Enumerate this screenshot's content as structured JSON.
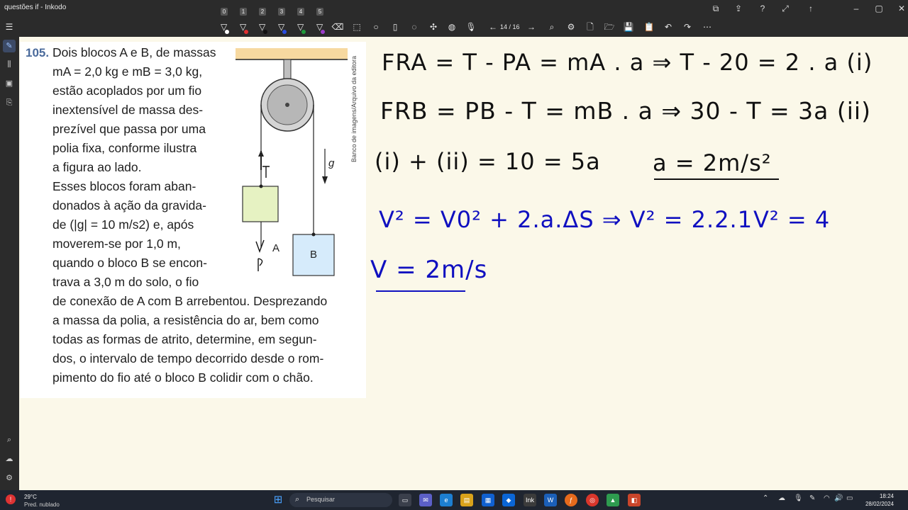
{
  "window": {
    "title": "questões if - Inkodo"
  },
  "toolbar": {
    "pens": [
      {
        "num": "0",
        "color": "#ffffff"
      },
      {
        "num": "1",
        "color": "#e03030"
      },
      {
        "num": "2",
        "color": "#111111"
      },
      {
        "num": "3",
        "color": "#2a4de0"
      },
      {
        "num": "4",
        "color": "#1f9a3a"
      },
      {
        "num": "5",
        "color": "#9b3dc9"
      }
    ],
    "page_indicator": "14 / 16"
  },
  "question": {
    "number": "105.",
    "lines_narrow": [
      "Dois blocos A e B, de massas",
      "mA = 2,0 kg e mB = 3,0 kg,",
      "estão acoplados por um fio",
      "inextensível de massa des-",
      "prezível que passa por uma",
      "polia fixa, conforme ilustra",
      "a figura ao lado.",
      "Esses blocos foram aban-",
      "donados à ação da gravida-",
      "de (|g| = 10 m/s2) e, após",
      "moverem-se por 1,0 m,",
      "quando o bloco B se encon-",
      "trava a 3,0 m do solo, o fio"
    ],
    "lines_wide": [
      "de conexão de A com B arrebentou. Desprezando",
      "a massa da polia, a resistência do ar, bem como",
      "todas as formas de atrito, determine, em segun-",
      "dos, o intervalo de tempo decorrido desde o rom-",
      "pimento do fio até o bloco B colidir com o chão."
    ],
    "figure": {
      "block_a": "A",
      "block_b": "B",
      "g_label": "g",
      "tension_label": "T",
      "weight_label": "PA",
      "credit": "Banco de imagens/Arquivo da editora"
    }
  },
  "notes": {
    "line1": "FRA = T - PA = mA . a ⇒  T - 20 = 2 . a (i)",
    "line2": "FRB = PB - T = mB . a ⇒ 30 - T = 3a (ii)",
    "line3a": "(i) + (ii) =  10 = 5a",
    "line3b": "a = 2m/s²",
    "line4a": "V² = V0² + 2.a.ΔS ⇒ V² = 2.2.1",
    "line4b": "V² = 4",
    "line5": "V = 2m/s",
    "colors": {
      "black": "#111111",
      "blue": "#1010c0"
    }
  },
  "taskbar": {
    "weather_temp": "29°C",
    "weather_desc": "Pred. nublado",
    "search_placeholder": "Pesquisar",
    "time": "18:24",
    "date": "28/02/2024"
  }
}
